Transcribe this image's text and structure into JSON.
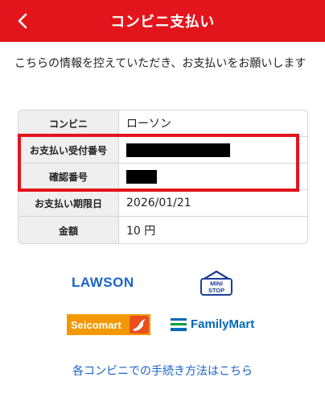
{
  "header": {
    "title": "コンビニ支払い",
    "back_icon": "chevron-left-icon",
    "background": "#e3151c"
  },
  "intro": {
    "text": "こちらの情報を控えていただき、お支払いをお願いします"
  },
  "payment_info": {
    "rows": [
      {
        "label": "コンビニ",
        "value": "ローソン"
      },
      {
        "label": "お支払い受付番号",
        "value": "[redacted]"
      },
      {
        "label": "確認番号",
        "value": "[redacted]"
      },
      {
        "label": "お支払い期限日",
        "value": "2026/01/21"
      },
      {
        "label": "金額",
        "value": "10 円"
      }
    ],
    "highlight_color": "#e3151c"
  },
  "logos": {
    "lawson": "LAWSON",
    "ministop": "MINI STOP",
    "seicomart": "Seicomart",
    "familymart": "FamilyMart"
  },
  "procedure_link": {
    "label": "各コンビニでの手続き方法はこちら",
    "color": "#1a63c9"
  }
}
